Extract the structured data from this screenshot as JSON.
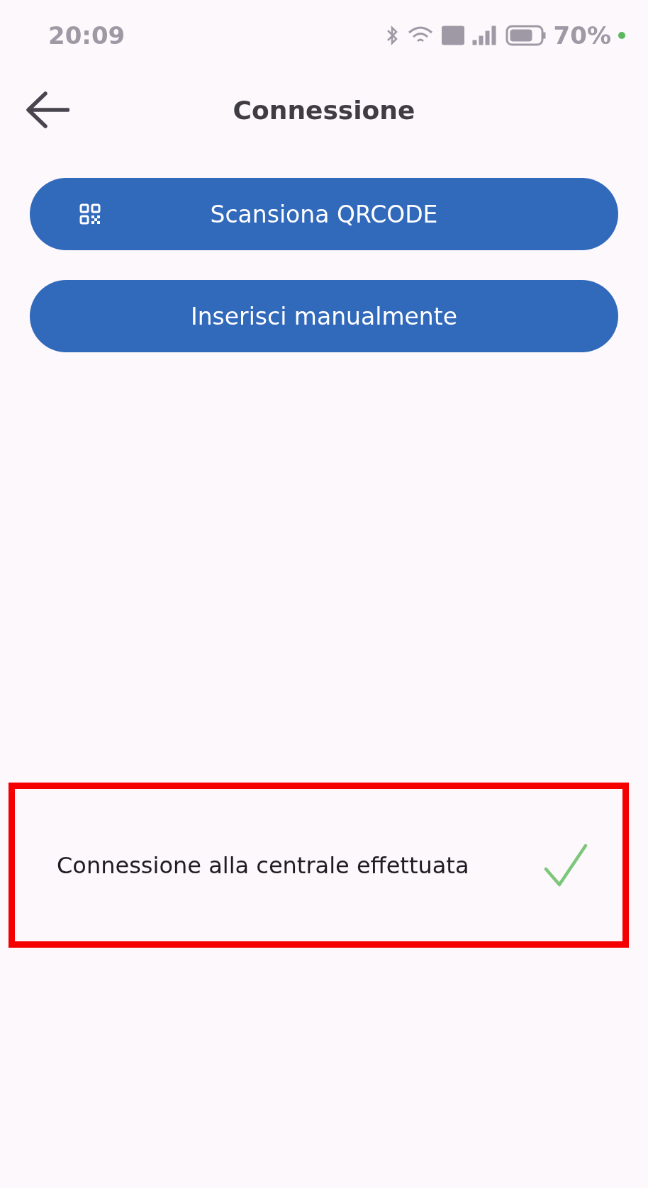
{
  "status_bar": {
    "time": "20:09",
    "battery": "70%"
  },
  "header": {
    "title": "Connessione"
  },
  "buttons": [
    {
      "label": "Scansiona QRCODE",
      "kind": "qr"
    },
    {
      "label": "Inserisci manualmente",
      "kind": "plain"
    }
  ],
  "result": {
    "message": "Connessione alla centrale effettuata",
    "success": true,
    "highlighted": true
  }
}
